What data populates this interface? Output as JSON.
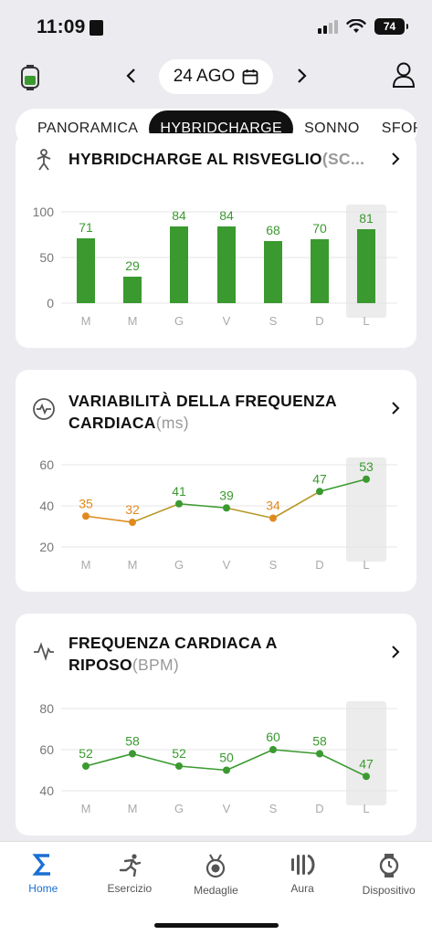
{
  "status_bar": {
    "time": "11:09",
    "battery": "74"
  },
  "nav": {
    "date": "24 AGO"
  },
  "tabs": [
    {
      "label": "PANORAMICA"
    },
    {
      "label": "HYBRIDCHARGE"
    },
    {
      "label": "SONNO"
    },
    {
      "label": "SFORZO"
    }
  ],
  "cards": {
    "hybridcharge": {
      "title": "HYBRIDCHARGE AL RISVEGLIO",
      "unit": "(SC..."
    },
    "hrv": {
      "title_line1": "VARIABILITÀ DELLA FREQUENZA",
      "title_line2": "CARDIACA",
      "unit": "(ms)"
    },
    "rhr": {
      "title_line1": "FREQUENZA CARDIACA A",
      "title_line2": "RIPOSO",
      "unit": "(BPM)"
    }
  },
  "chart_data": [
    {
      "type": "bar",
      "categories": [
        "M",
        "M",
        "G",
        "V",
        "S",
        "D",
        "L"
      ],
      "values": [
        71,
        29,
        84,
        84,
        68,
        70,
        81
      ],
      "title": "HYBRIDCHARGE AL RISVEGLIO",
      "ylim": [
        0,
        100
      ],
      "yticks": [
        0,
        50,
        100
      ],
      "grid": true,
      "bar_color": "#3a9a2f",
      "highlight_index": 6
    },
    {
      "type": "line",
      "categories": [
        "M",
        "M",
        "G",
        "V",
        "S",
        "D",
        "L"
      ],
      "values": [
        35,
        32,
        41,
        39,
        34,
        47,
        53
      ],
      "point_colors": [
        "#e08a1e",
        "#e08a1e",
        "#3a9a2f",
        "#3a9a2f",
        "#e08a1e",
        "#3a9a2f",
        "#3a9a2f"
      ],
      "title": "VARIABILITÀ DELLA FREQUENZA CARDIACA",
      "ylim": [
        20,
        60
      ],
      "yticks": [
        20,
        40,
        60
      ],
      "grid": true,
      "highlight_index": 6
    },
    {
      "type": "line",
      "categories": [
        "M",
        "M",
        "G",
        "V",
        "S",
        "D",
        "L"
      ],
      "values": [
        52,
        58,
        52,
        50,
        60,
        58,
        47
      ],
      "title": "FREQUENZA CARDIACA A RIPOSO",
      "ylim": [
        40,
        80
      ],
      "yticks": [
        40,
        60,
        80
      ],
      "grid": true,
      "line_color": "#3a9a2f",
      "highlight_index": 6
    }
  ],
  "bottom_nav": [
    {
      "label": "Home",
      "icon": "sigma-icon"
    },
    {
      "label": "Esercizio",
      "icon": "runner-icon"
    },
    {
      "label": "Medaglie",
      "icon": "medal-icon"
    },
    {
      "label": "Aura",
      "icon": "aura-icon"
    },
    {
      "label": "Dispositivo",
      "icon": "watch-icon"
    }
  ],
  "colors": {
    "accent": "#1a6fd4",
    "green": "#3a9a2f",
    "orange": "#e08a1e"
  }
}
